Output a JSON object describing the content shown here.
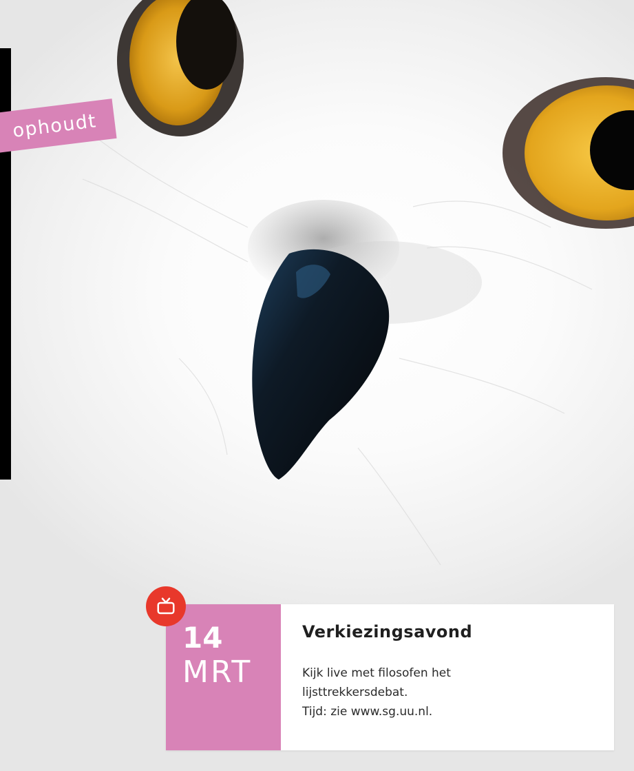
{
  "hero": {
    "image_alt": "owl-closeup-photo"
  },
  "tag": {
    "text": "ophoudt"
  },
  "event": {
    "day": "14",
    "month": "MRT",
    "title": "Verkiezingsavond",
    "description_lines": [
      "Kijk live met filosofen het",
      "lijsttrekkersdebat.",
      "Tijd: zie www.sg.uu.nl."
    ],
    "badge_icon": "tv-icon"
  },
  "colors": {
    "accent_pink": "#d883b7",
    "badge_red": "#e8382b",
    "black": "#000000",
    "owl_eye": "#e3a51d"
  }
}
